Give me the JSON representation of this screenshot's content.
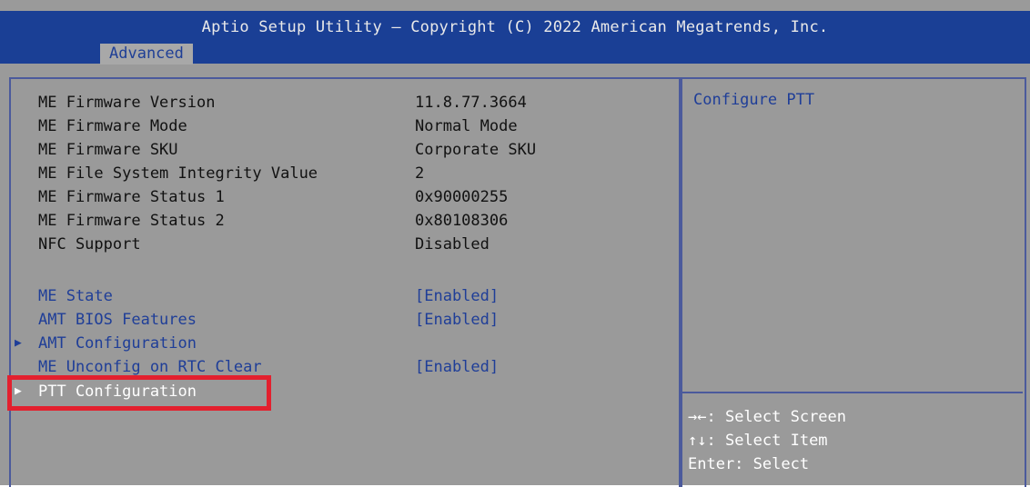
{
  "header": {
    "title": "Aptio Setup Utility – Copyright (C) 2022 American Megatrends, Inc.",
    "active_tab": "Advanced"
  },
  "info_rows": [
    {
      "label": "ME Firmware Version",
      "value": "11.8.77.3664"
    },
    {
      "label": "ME Firmware Mode",
      "value": "Normal Mode"
    },
    {
      "label": "ME Firmware SKU",
      "value": "Corporate SKU"
    },
    {
      "label": "ME File System Integrity Value",
      "value": "2"
    },
    {
      "label": "ME Firmware Status 1",
      "value": "0x90000255"
    },
    {
      "label": "ME Firmware Status 2",
      "value": "0x80108306"
    },
    {
      "label": "NFC Support",
      "value": "Disabled"
    }
  ],
  "settings": {
    "me_state": {
      "label": "ME State",
      "value": "[Enabled]"
    },
    "amt_bios_features": {
      "label": "AMT BIOS Features",
      "value": "[Enabled]"
    },
    "amt_configuration": {
      "label": "AMT Configuration"
    },
    "me_unconfig_rtc_clear": {
      "label": "ME Unconfig on RTC Clear",
      "value": "[Enabled]"
    },
    "ptt_configuration": {
      "label": "PTT Configuration"
    }
  },
  "submenu_arrow_glyph": "▶",
  "help": {
    "text": "Configure PTT"
  },
  "key_help": [
    {
      "glyph": "→←",
      "text": ": Select Screen"
    },
    {
      "glyph": "↑↓",
      "text": ": Select Item"
    },
    {
      "text": "Enter: Select"
    }
  ],
  "colors": {
    "title_bg": "#1a3f95",
    "body_bg": "#9a9a9a",
    "option_text": "#1f3e98",
    "selected_text": "#ffffff",
    "highlight_box": "#e3202e"
  }
}
